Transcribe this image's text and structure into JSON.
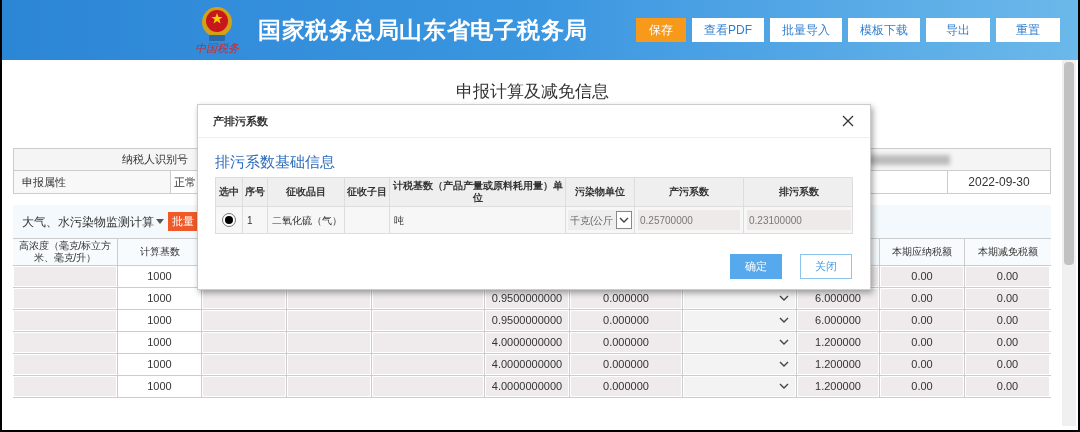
{
  "header": {
    "logo_text": "中国税务",
    "title": "国家税务总局山东省电子税务局",
    "buttons": [
      {
        "label": "保存",
        "primary": true
      },
      {
        "label": "查看PDF",
        "primary": false
      },
      {
        "label": "批量导入",
        "primary": false
      },
      {
        "label": "模板下载",
        "primary": false
      },
      {
        "label": "导出",
        "primary": false
      },
      {
        "label": "重置",
        "primary": false
      }
    ]
  },
  "page": {
    "title": "申报计算及减免信息",
    "info": {
      "taxpayer_id_label": "纳税人识别号",
      "filing_type_label": "申报属性",
      "filing_type_value": "正常",
      "period_end": "2022-09-30"
    },
    "section": {
      "title": "大气、水污染物监测计算",
      "action": "批量"
    },
    "table": {
      "columns": [
        {
          "label": "高浓度（毫克/标立方米、毫克/升）"
        },
        {
          "label": "计算基数"
        },
        {},
        {},
        {},
        {},
        {},
        {},
        {},
        {
          "label": "本期应纳税额"
        },
        {
          "label": "本期减免税额"
        }
      ],
      "rows": [
        {
          "calc_base": "1000",
          "tax_payable": "0.00",
          "tax_relief": "0.00"
        },
        {
          "calc_base": "1000",
          "value_a": "0.9500000000",
          "value_b": "0.000000",
          "value_c": "6.000000",
          "tax_payable": "0.00",
          "tax_relief": "0.00"
        },
        {
          "calc_base": "1000",
          "value_a": "0.9500000000",
          "value_b": "0.000000",
          "value_c": "6.000000",
          "tax_payable": "0.00",
          "tax_relief": "0.00"
        },
        {
          "calc_base": "1000",
          "value_a": "4.0000000000",
          "value_b": "0.000000",
          "value_c": "1.200000",
          "tax_payable": "0.00",
          "tax_relief": "0.00"
        },
        {
          "calc_base": "1000",
          "value_a": "4.0000000000",
          "value_b": "0.000000",
          "value_c": "1.200000",
          "tax_payable": "0.00",
          "tax_relief": "0.00"
        },
        {
          "calc_base": "1000",
          "value_a": "4.0000000000",
          "value_b": "0.000000",
          "value_c": "1.200000",
          "tax_payable": "0.00",
          "tax_relief": "0.00"
        }
      ]
    }
  },
  "dialog": {
    "title": "产排污系数",
    "section_title": "排污系数基础信息",
    "columns": [
      "选中",
      "序号",
      "征收品目",
      "征收子目",
      "计税基数（产品产量或原料耗用量）单位",
      "污染物单位",
      "产污系数",
      "排污系数"
    ],
    "rows": [
      {
        "selected": true,
        "index": "1",
        "item": "二氧化硫（气）",
        "unit": "吨",
        "pollutant_unit": "千克(公斤",
        "production_coef": "0.25700000",
        "emission_coef": "0.23100000"
      }
    ],
    "buttons": [
      {
        "label": "确定",
        "primary": true
      },
      {
        "label": "关闭",
        "primary": false
      }
    ]
  }
}
